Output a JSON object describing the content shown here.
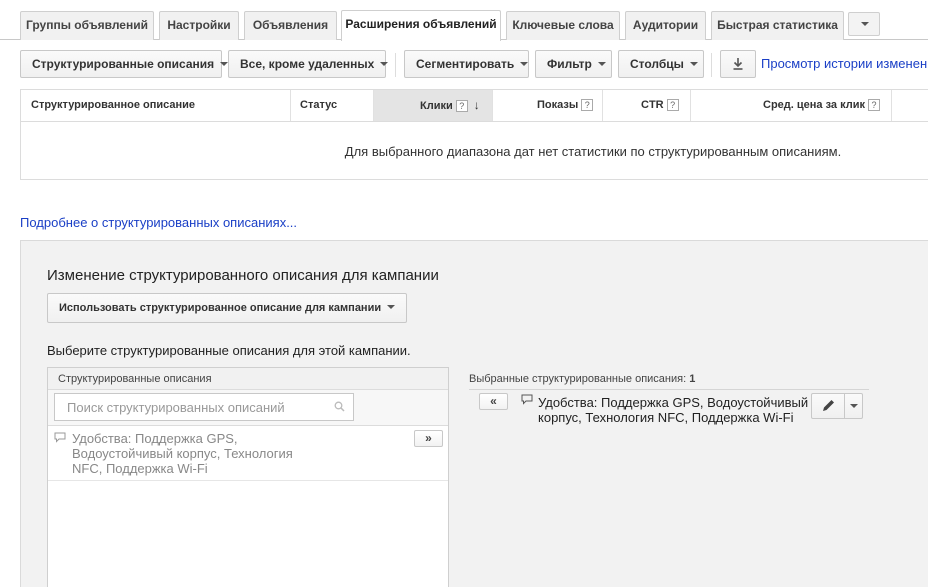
{
  "tabs": [
    {
      "label": "Группы объявлений"
    },
    {
      "label": "Настройки"
    },
    {
      "label": "Объявления"
    },
    {
      "label": "Расширения объявлений"
    },
    {
      "label": "Ключевые слова"
    },
    {
      "label": "Аудитории"
    },
    {
      "label": "Быстрая статистика"
    }
  ],
  "toolbar": {
    "type_label": "Структурированные описания",
    "state_label": "Все, кроме удаленных",
    "segment_label": "Сегментировать",
    "filter_label": "Фильтр",
    "columns_label": "Столбцы",
    "history_link": "Просмотр истории изменений"
  },
  "table": {
    "columns": [
      {
        "label": "Структурированное описание"
      },
      {
        "label": "Статус"
      },
      {
        "label": "Клики"
      },
      {
        "label": "Показы"
      },
      {
        "label": "CTR"
      },
      {
        "label": "Сред. цена за клик"
      }
    ],
    "help_mark": "?",
    "sort_arrow": "↓",
    "empty_message": "Для выбранного диапазона дат нет статистики по структурированным описаниям."
  },
  "learn_more_link": "Подробнее о структурированных описаниях...",
  "panel": {
    "title": "Изменение структурированного описания для кампании",
    "campaign_button": "Использовать структурированное описание для кампании",
    "select_label": "Выберите структурированные описания для этой кампании.",
    "available": {
      "header": "Структурированные описания",
      "search_placeholder": "Поиск структурированных описаний",
      "items": [
        {
          "text": "Удобства: Поддержка GPS, Водоустойчивый корпус, Технология NFC, Поддержка Wi-Fi",
          "add_label": "»"
        }
      ]
    },
    "selected": {
      "header": "Выбранные структурированные описания:",
      "count": "1",
      "items": [
        {
          "text": "Удобства: Поддержка GPS, Водоустойчивый корпус, Технология NFC, Поддержка Wi-Fi",
          "remove_label": "«"
        }
      ]
    }
  },
  "colors": {
    "link": "#1a3fc6",
    "panel_bg": "#f2f2f2",
    "sorted_col": "#e4e4e4"
  }
}
